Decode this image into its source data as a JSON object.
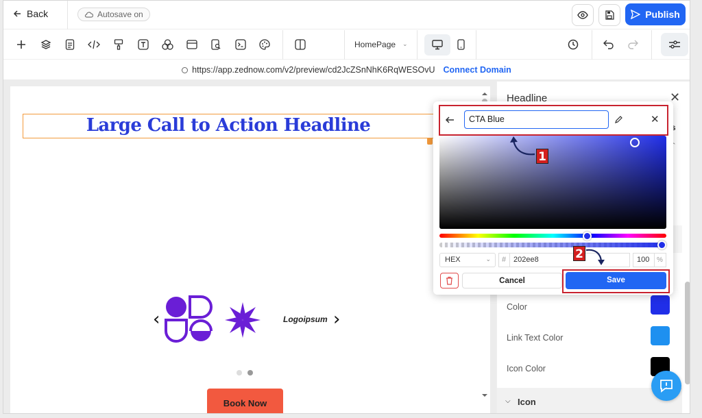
{
  "topbar": {
    "back_label": "Back",
    "autosave_label": "Autosave on",
    "publish_label": "Publish"
  },
  "toolbar": {
    "page_select": "HomePage"
  },
  "urlbar": {
    "url": "https://app.zednow.com/v2/preview/cd2JcZSnNhK6RqWESOvU",
    "connect_label": "Connect Domain"
  },
  "canvas": {
    "headline": "Large Call to Action Headline",
    "logo_text": "Logoipsum",
    "button_label": "Book Now",
    "carousel": {
      "prev": "‹",
      "next": "›"
    }
  },
  "panel": {
    "title": "Headline",
    "tab_fragment": "s",
    "properties": [
      {
        "label": "Color",
        "value": "#202ee8"
      },
      {
        "label": "Link Text Color",
        "value": "#1e90f0"
      },
      {
        "label": "Icon Color",
        "value": "#000000"
      }
    ],
    "section_label": "Icon"
  },
  "color_picker": {
    "name": "CTA Blue",
    "format": "HEX",
    "hash": "#",
    "hex": "202ee8",
    "alpha": "100",
    "alpha_unit": "%",
    "cancel_label": "Cancel",
    "save_label": "Save",
    "current_color": "#202ee8"
  },
  "annotations": {
    "step1": "1",
    "step2": "2"
  },
  "colors": {
    "primary": "#2166f3",
    "headline": "#2a3cd8",
    "highlight_border": "#c8232f",
    "button": "#f2593f",
    "logo_purple": "#6a1ed6"
  }
}
